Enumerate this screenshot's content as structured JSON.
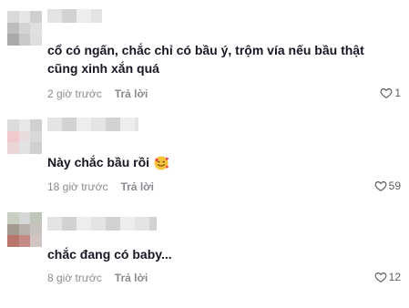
{
  "comments": [
    {
      "text": "cổ có ngấn, chắc chỉ có bầu ý, trộm vía nếu bầu thật cũng xinh xắn quá",
      "time": "2 giờ trước",
      "reply_label": "Trả lời",
      "likes": "1"
    },
    {
      "text": "Này chắc bầu rồi",
      "emoji": "smiling-face-with-hearts",
      "time": "18 giờ trước",
      "reply_label": "Trả lời",
      "likes": "59"
    },
    {
      "text": "chắc đang có baby...",
      "time": "8 giờ trước",
      "reply_label": "Trả lời",
      "likes": "12"
    }
  ],
  "colors": {
    "text": "#161823",
    "meta": "#8a8b91",
    "avatar1": [
      "#d9d9d9",
      "#e6e6e6",
      "#cfcfcf",
      "#bdbdbd",
      "#d4d4d4",
      "#e0e0e0",
      "#a9a9a9",
      "#c9c9c9",
      "#dedede"
    ],
    "avatar2": [
      "#dcdcdc",
      "#e8e8e8",
      "#d0d0d0",
      "#f0c9cc",
      "#e9dcdc",
      "#d8d8d8",
      "#ead6d6",
      "#e2e2e2",
      "#cfcfcf"
    ],
    "avatar3": [
      "#c8cfc0",
      "#d6d6d6",
      "#bfc6b8",
      "#a59a90",
      "#b8b0aa",
      "#c9c3bf",
      "#b8766d",
      "#c48a86",
      "#d0c5c0"
    ]
  }
}
